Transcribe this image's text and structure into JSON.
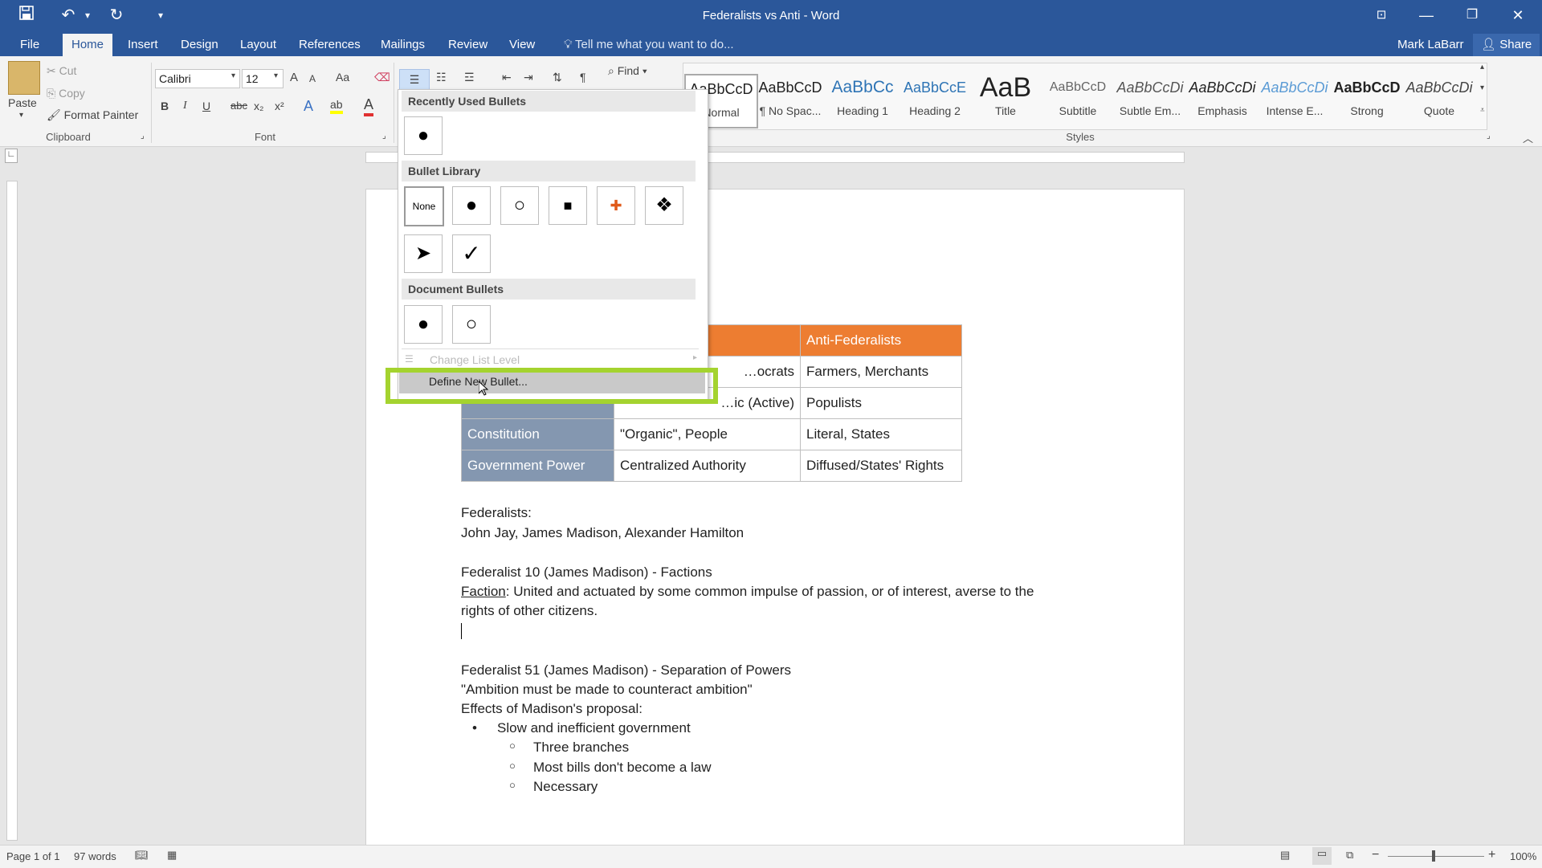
{
  "window": {
    "title": "Federalists vs Anti - Word"
  },
  "quick_access": {
    "save_icon": "save-icon",
    "undo_icon": "undo-icon",
    "redo_icon": "redo-icon"
  },
  "tabs": [
    "File",
    "Home",
    "Insert",
    "Design",
    "Layout",
    "References",
    "Mailings",
    "Review",
    "View"
  ],
  "tell_me": "Tell me what you want to do...",
  "user": {
    "name": "Mark LaBarr",
    "share": "Share"
  },
  "clipboard": {
    "paste": "Paste",
    "cut": "Cut",
    "copy": "Copy",
    "format_painter": "Format Painter",
    "label": "Clipboard"
  },
  "font": {
    "name": "Calibri",
    "size": "12",
    "label": "Font",
    "bold": "B",
    "italic": "I",
    "underline": "U",
    "strike": "abc",
    "sub": "x₂",
    "sup": "x²",
    "case": "Aa",
    "grow": "A",
    "shrink": "A"
  },
  "editing": {
    "find": "Find"
  },
  "styles": {
    "label": "Styles",
    "items": [
      {
        "preview": "AaBbCcD",
        "label": "Normal"
      },
      {
        "preview": "AaBbCcD",
        "label": "¶ No Spac..."
      },
      {
        "preview": "AaBbCc",
        "label": "Heading 1"
      },
      {
        "preview": "AaBbCcE",
        "label": "Heading 2"
      },
      {
        "preview": "AaB",
        "label": "Title"
      },
      {
        "preview": "AaBbCcD",
        "label": "Subtitle"
      },
      {
        "preview": "AaBbCcDi",
        "label": "Subtle Em..."
      },
      {
        "preview": "AaBbCcDi",
        "label": "Emphasis"
      },
      {
        "preview": "AaBbCcDi",
        "label": "Intense E..."
      },
      {
        "preview": "AaBbCcD",
        "label": "Strong"
      },
      {
        "preview": "AaBbCcDi",
        "label": "Quote"
      }
    ]
  },
  "bullets_menu": {
    "recent_header": "Recently Used Bullets",
    "library_header": "Bullet Library",
    "document_header": "Document Bullets",
    "none_label": "None",
    "change_level": "Change List Level",
    "define_new": "Define New Bullet...",
    "recent": [
      "●"
    ],
    "library": [
      "●",
      "○",
      "■",
      "✚",
      "❖",
      "➤",
      "✓"
    ],
    "document": [
      "●",
      "○"
    ]
  },
  "table": {
    "header": [
      "Anti-Federalists"
    ],
    "rows": [
      [
        "",
        "…ocrats",
        "Farmers, Merchants"
      ],
      [
        "",
        "…ic (Active)",
        "Populists"
      ],
      [
        "Constitution",
        "\"Organic\", People",
        "Literal, States"
      ],
      [
        "Government Power",
        "Centralized Authority",
        "Diffused/States' Rights"
      ]
    ]
  },
  "document": {
    "lines": [
      "Federalists:",
      "John Jay, James Madison, Alexander Hamilton",
      "Federalist 10 (James Madison) - Factions",
      "Faction",
      ": United and actuated by some common impulse of passion, or of interest, averse to the",
      "rights of other citizens.",
      "Federalist 51 (James Madison) - Separation of Powers",
      "\"Ambition must be made to counteract ambition\"",
      "Effects of Madison's proposal:"
    ],
    "bullet_main": "Slow and inefficient government",
    "sub_bullets": [
      "Three branches",
      "Most bills don't become a law",
      "Necessary"
    ]
  },
  "status": {
    "page": "Page 1 of 1",
    "words": "97 words",
    "zoom": "100%"
  },
  "colors": {
    "brand": "#2b579a",
    "table_orange": "#ed7d31",
    "table_blue": "#8497b0",
    "highlight": "#a4d32f"
  }
}
